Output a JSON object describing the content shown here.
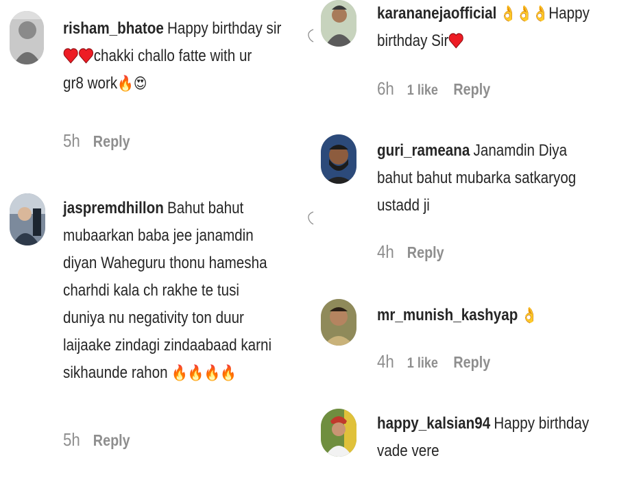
{
  "comments_left": [
    {
      "username": "risham_bhatoe",
      "lines": [
        "Happy birthday sir",
        "chakki challo fatte with ur",
        "gr8 work"
      ],
      "time": "5h",
      "reply_label": "Reply"
    },
    {
      "username": "jaspremdhillon",
      "lines": [
        "Bahut bahut",
        "mubaarkan baba jee janamdin",
        "diyan Waheguru thonu hamesha",
        "charhdi kala ch rakhe te tusi",
        "duniya nu negativity ton duur",
        "laijaake zindagi zindaabaad karni",
        "sikhaunde rahon"
      ],
      "time": "5h",
      "reply_label": "Reply"
    }
  ],
  "comments_right": [
    {
      "username": "karananejaofficial",
      "lines": [
        "Happy",
        "birthday Sir"
      ],
      "time": "6h",
      "likes": "1 like",
      "reply_label": "Reply"
    },
    {
      "username": "guri_rameana",
      "lines": [
        "Janamdin Diya",
        "bahut bahut mubarka satkaryog",
        "ustadd ji"
      ],
      "time": "4h",
      "reply_label": "Reply"
    },
    {
      "username": "mr_munish_kashyap",
      "lines": [
        ""
      ],
      "time": "4h",
      "likes": "1 like",
      "reply_label": "Reply"
    },
    {
      "username": "happy_kalsian94",
      "lines": [
        "Happy birthday",
        "vade vere"
      ],
      "reply_label": ""
    }
  ],
  "icons": {
    "heart": "heart-icon",
    "fire": "fire-emoji",
    "heart_eyes": "heart-eyes-emoji",
    "ok_hand": "ok-hand-emoji",
    "like": "heart-outline-icon"
  },
  "colors": {
    "text": "#262626",
    "muted": "#8e8e8e",
    "heart": "#ed1c24"
  }
}
